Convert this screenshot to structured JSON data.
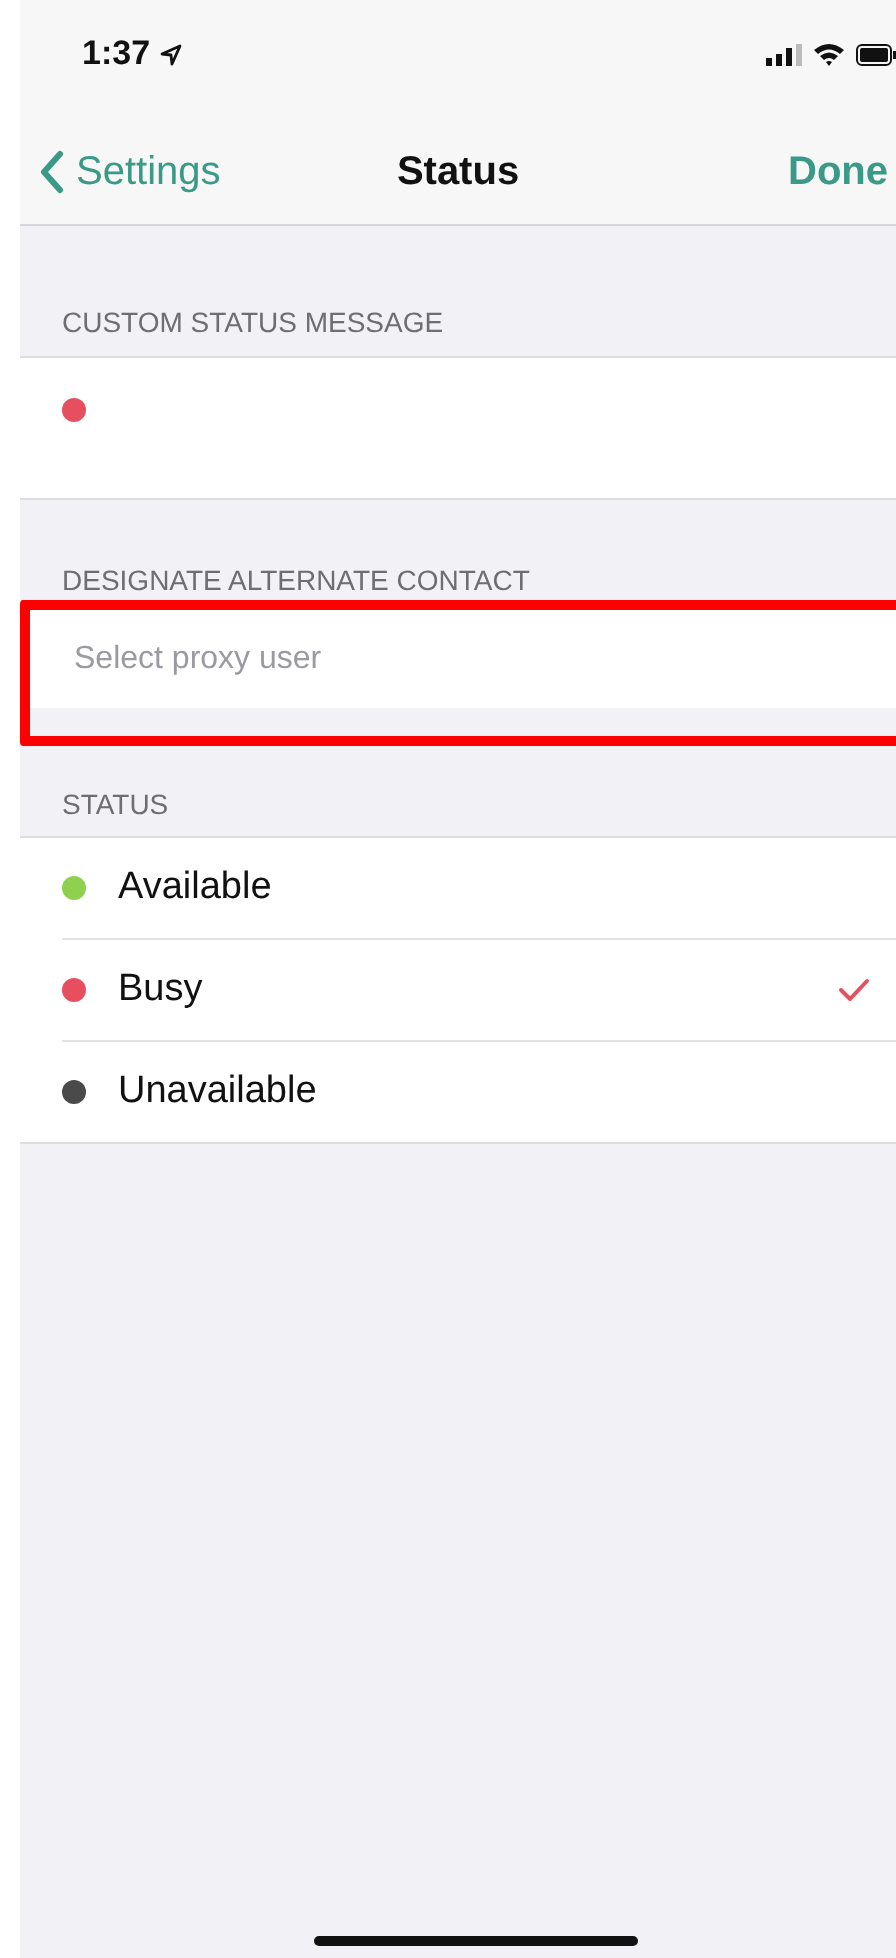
{
  "status_bar": {
    "time": "1:37"
  },
  "nav": {
    "back": "Settings",
    "title": "Status",
    "done": "Done"
  },
  "custom_message": {
    "header": "CUSTOM STATUS MESSAGE",
    "color": "#e84f5e"
  },
  "alternate_contact": {
    "header": "DESIGNATE ALTERNATE CONTACT",
    "placeholder": "Select proxy user",
    "highlighted": true
  },
  "status": {
    "header": "STATUS",
    "options": [
      {
        "label": "Available",
        "color": "#8fd14f",
        "selected": false
      },
      {
        "label": "Busy",
        "color": "#e84f5e",
        "selected": true
      },
      {
        "label": "Unavailable",
        "color": "#4a4a4a",
        "selected": false
      }
    ]
  }
}
